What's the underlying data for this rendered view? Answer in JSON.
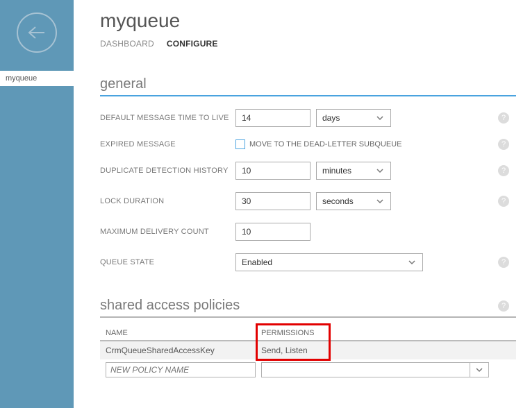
{
  "sidebar": {
    "item": "myqueue"
  },
  "header": {
    "title": "myqueue",
    "tabs": {
      "dashboard": "DASHBOARD",
      "configure": "CONFIGURE"
    }
  },
  "sections": {
    "general": {
      "title": "general",
      "fields": {
        "ttl": {
          "label": "DEFAULT MESSAGE TIME TO LIVE",
          "value": "14",
          "unit": "days"
        },
        "expired": {
          "label": "EXPIRED MESSAGE",
          "checkbox_label": "MOVE TO THE DEAD-LETTER SUBQUEUE"
        },
        "dup": {
          "label": "DUPLICATE DETECTION HISTORY",
          "value": "10",
          "unit": "minutes"
        },
        "lock": {
          "label": "LOCK DURATION",
          "value": "30",
          "unit": "seconds"
        },
        "maxdel": {
          "label": "MAXIMUM DELIVERY COUNT",
          "value": "10"
        },
        "state": {
          "label": "QUEUE STATE",
          "value": "Enabled"
        }
      }
    },
    "sap": {
      "title": "shared access policies",
      "header": {
        "name": "NAME",
        "perm": "PERMISSIONS"
      },
      "rows": [
        {
          "name": "CrmQueueSharedAccessKey",
          "perm": "Send, Listen"
        }
      ],
      "new_placeholder": "NEW POLICY NAME"
    }
  },
  "help_glyph": "?"
}
